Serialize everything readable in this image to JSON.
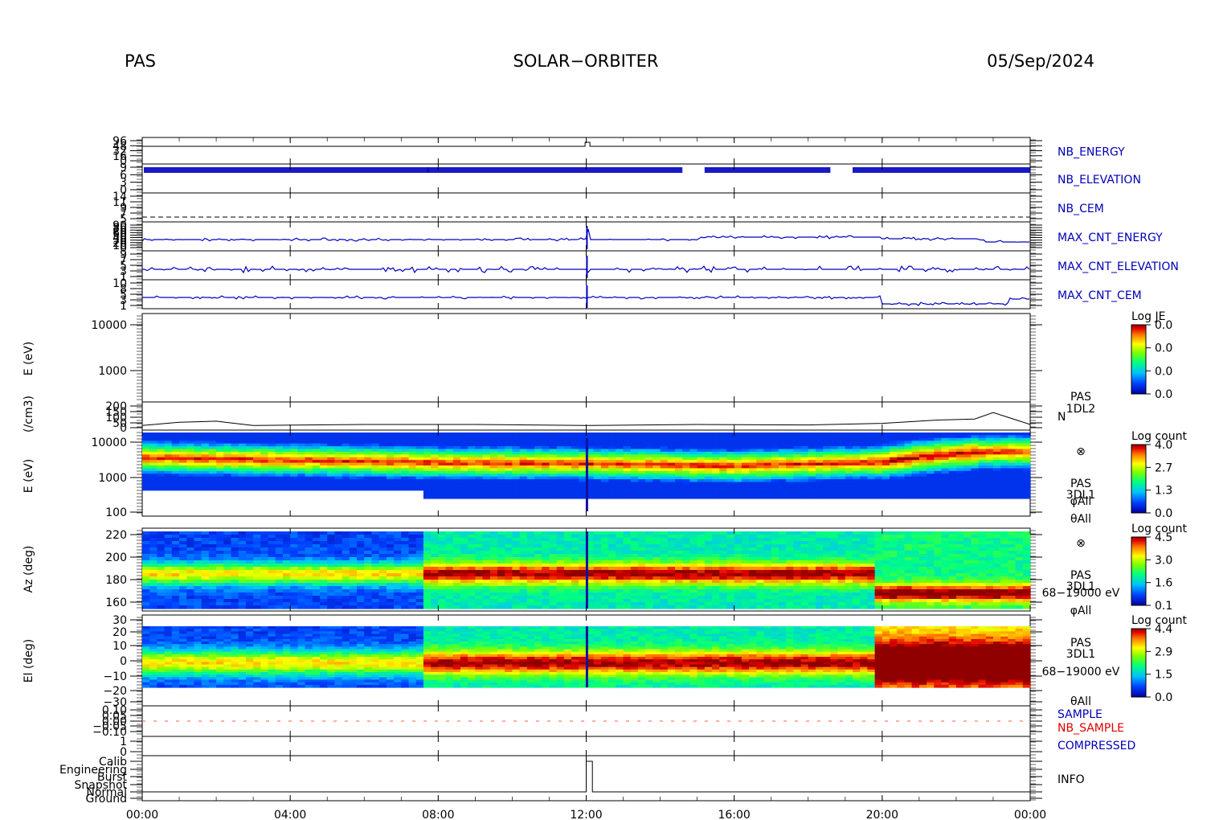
{
  "header": {
    "left": "PAS",
    "center": "SOLAR−ORBITER",
    "right": "05/Sep/2024"
  },
  "time_ticks": [
    "00:00",
    "04:00",
    "08:00",
    "12:00",
    "16:00",
    "20:00",
    "00:00"
  ],
  "colors": {
    "trace": "#0000c0",
    "dashed_red": "#ff6040",
    "label_blue": "#0000b8",
    "label_red": "#e00000",
    "colorbar": [
      "#ffffff",
      "#0000a0",
      "#0060ff",
      "#00e0ff",
      "#00ff60",
      "#c0ff00",
      "#ffe000",
      "#ff8000",
      "#e00000",
      "#800000"
    ]
  },
  "strip_panels": [
    {
      "label": "NB_ENERGY",
      "ticks": [
        "96",
        "48",
        "32",
        "16",
        "0"
      ]
    },
    {
      "label": "NB_ELEVATION",
      "ticks": [
        "9",
        "6",
        "3",
        "0"
      ]
    },
    {
      "label": "NB_CEM",
      "ticks": [
        "14",
        "11",
        "9",
        "7",
        "5"
      ]
    },
    {
      "label": "MAX_CNT_ENERGY",
      "ticks": [
        "90",
        "80",
        "70",
        "60",
        "50",
        "40",
        "30",
        "20",
        "10",
        "0"
      ]
    },
    {
      "label": "MAX_CNT_ELEVATION",
      "ticks": [
        "9",
        "7",
        "5",
        "3",
        "1"
      ]
    },
    {
      "label": "MAX_CNT_CEM",
      "ticks": [
        "10",
        "8",
        "5",
        "3",
        "1"
      ]
    }
  ],
  "panel_e_empty": {
    "ylabel": "E (eV)",
    "ticks": [
      "10000",
      "1000"
    ],
    "colorbar": {
      "title": "Log JE",
      "ticks": [
        "0.0",
        "0.0",
        "0.0",
        "0.0"
      ]
    }
  },
  "panel_density": {
    "ylabel": "(/cm3)",
    "ticks": [
      "200",
      "150",
      "100",
      "50",
      "0"
    ],
    "label_lines": [
      "PAS",
      "1DL2"
    ],
    "trace_label": "N"
  },
  "panel_e_spec": {
    "ylabel": "E (eV)",
    "ticks": [
      "10000",
      "1000",
      "100"
    ],
    "colorbar": {
      "title": "Log count",
      "ticks": [
        "4.0",
        "2.7",
        "1.3",
        "0.0"
      ]
    },
    "symbol": "⊗",
    "label_lines": [
      "PAS",
      "3DL1",
      "φAll",
      "θAll"
    ]
  },
  "panel_az": {
    "ylabel": "Az (deg)",
    "ticks": [
      "220",
      "200",
      "180",
      "160"
    ],
    "colorbar": {
      "title": "Log count",
      "ticks": [
        "4.5",
        "3.0",
        "1.6",
        "0.1"
      ]
    },
    "symbol": "⊗",
    "label_lines": [
      "PAS",
      "3DL1",
      "68−19000 eV",
      "φAll"
    ]
  },
  "panel_el": {
    "ylabel": "El (deg)",
    "ticks": [
      "30",
      "20",
      "10",
      "0",
      "−10",
      "−20",
      "−30"
    ],
    "colorbar": {
      "title": "Log count",
      "ticks": [
        "4.4",
        "2.9",
        "1.5",
        "0.0"
      ]
    },
    "label_lines": [
      "PAS",
      "3DL1",
      "68−19000 eV",
      "θAll"
    ]
  },
  "panel_sample": {
    "ticks": [
      "0.10",
      "0.05",
      "0.00",
      "−0.05",
      "−0.10"
    ],
    "label_blue": "SAMPLE",
    "label_red": "NB_SAMPLE"
  },
  "panel_compressed": {
    "ticks": [
      "1",
      "0"
    ],
    "label": "COMPRESSED"
  },
  "panel_info": {
    "ticks": [
      "Calib",
      "Engineering",
      "Burst",
      "Snapshot",
      "Normal",
      "Ground"
    ],
    "label": "INFO"
  },
  "chart_data": [
    {
      "type": "line",
      "panel": "NB_ENERGY",
      "x": [
        "00:00",
        "12:00",
        "12:10",
        "24:00"
      ],
      "y": [
        0,
        0,
        0,
        0
      ],
      "note": "flat at zero with a brief step near 12:00"
    },
    {
      "type": "line",
      "panel": "density",
      "ylabel": "(/cm3)",
      "ylim": [
        0,
        200
      ],
      "x": [
        "00:00",
        "01:00",
        "02:00",
        "02:30",
        "03:00",
        "06:00",
        "09:00",
        "12:00",
        "15:00",
        "18:00",
        "20:00",
        "21:30",
        "22:30",
        "23:00",
        "24:00"
      ],
      "y": [
        20,
        50,
        60,
        40,
        20,
        30,
        30,
        20,
        30,
        25,
        40,
        70,
        80,
        140,
        30
      ]
    },
    {
      "type": "heatmap",
      "panel": "E spectrogram",
      "ylabel": "E (eV)",
      "yscale": "log",
      "ylim": [
        100,
        19000
      ],
      "colorbar_label": "Log count",
      "colorbar_range": [
        0.0,
        4.0
      ],
      "peak_energy_eV": [
        {
          "x": "00:00",
          "y": 2500
        },
        {
          "x": "08:00",
          "y": 1700
        },
        {
          "x": "12:00",
          "y": 1600
        },
        {
          "x": "16:00",
          "y": 1300
        },
        {
          "x": "20:00",
          "y": 1800
        },
        {
          "x": "22:45",
          "y": 4000
        }
      ]
    },
    {
      "type": "heatmap",
      "panel": "Azimuth",
      "ylabel": "Az (deg)",
      "ylim": [
        155,
        225
      ],
      "colorbar_label": "Log count",
      "colorbar_range": [
        0.1,
        4.5
      ]
    },
    {
      "type": "heatmap",
      "panel": "Elevation",
      "ylabel": "El (deg)",
      "ylim": [
        -30,
        30
      ],
      "colorbar_label": "Log count",
      "colorbar_range": [
        0.0,
        4.4
      ]
    },
    {
      "type": "line",
      "panel": "INFO",
      "categories": [
        "Ground",
        "Normal",
        "Snapshot",
        "Burst",
        "Engineering",
        "Calib"
      ],
      "x": [
        "00:00",
        "12:00",
        "12:00",
        "12:10",
        "12:10",
        "24:00"
      ],
      "y": [
        "Normal",
        "Normal",
        "Calib",
        "Calib",
        "Normal",
        "Normal"
      ]
    }
  ]
}
